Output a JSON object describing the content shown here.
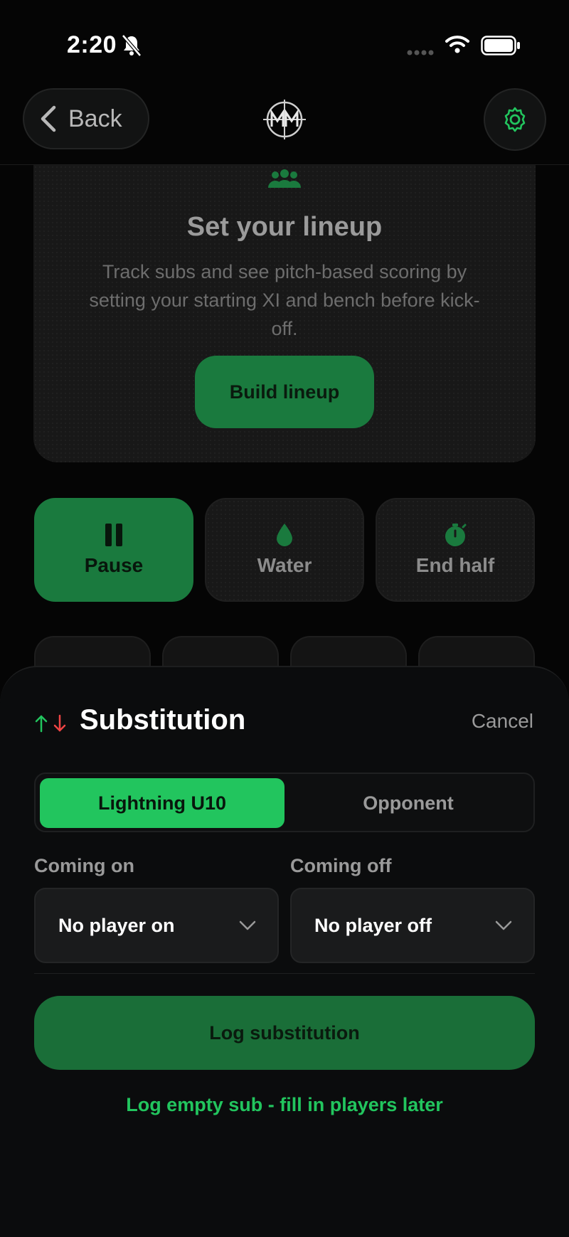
{
  "status_bar": {
    "time": "2:20"
  },
  "header": {
    "back_label": "Back"
  },
  "lineup_card": {
    "title": "Set your lineup",
    "description": "Track subs and see pitch-based scoring by setting your starting XI and bench before kick-off.",
    "build_button": "Build lineup"
  },
  "controls": [
    {
      "label": "Pause",
      "icon": "pause-icon",
      "active": true
    },
    {
      "label": "Water",
      "icon": "water-drop-icon",
      "active": false
    },
    {
      "label": "End half",
      "icon": "stopwatch-icon",
      "active": false
    }
  ],
  "sheet": {
    "title": "Substitution",
    "cancel_label": "Cancel",
    "teams": {
      "home": "Lightning U10",
      "opponent": "Opponent",
      "selected": "home"
    },
    "coming_on": {
      "label": "Coming on",
      "value": "No player on"
    },
    "coming_off": {
      "label": "Coming off",
      "value": "No player off"
    },
    "log_button": "Log substitution",
    "empty_sub_link": "Log empty sub - fill in players later"
  },
  "colors": {
    "accent": "#22c55e",
    "accent_dark": "#1a7a3e",
    "sub_on": "#22c55e",
    "sub_off": "#ef4444"
  }
}
